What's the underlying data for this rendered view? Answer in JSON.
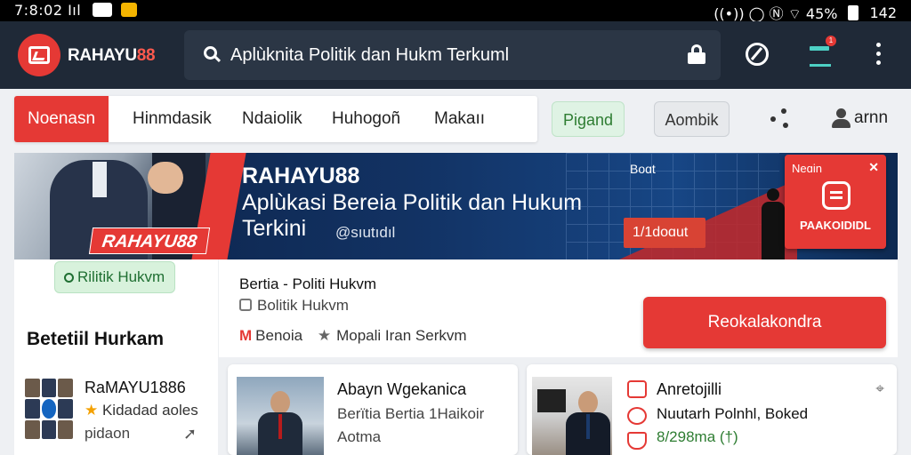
{
  "status_bar": {
    "time": "7:8:02 Iıl",
    "right_text": "((•)) ◯ Ⓝ  ⌔ 45%",
    "clock": "142"
  },
  "header": {
    "brand_prefix": "RAHAYU",
    "brand_suffix": "88",
    "search_value": "Aplùknita Politik dan Hukm Terkuml",
    "inbox_badge": "1"
  },
  "nav": {
    "tabs": [
      "Noenasn",
      "Hinmdasik",
      "Ndaiolik",
      "Huhogoñ",
      "Makaıı"
    ],
    "active_index": 0,
    "pill_green": "Pigand",
    "pill_gray": "Aombik",
    "user_label": "arnn"
  },
  "hero": {
    "tag": "RAHAYU88",
    "brand": "RAHAYU88",
    "title": "Aplùkasi Bereia Politik dan Hukum Terkini",
    "handle": "@sıutıdıl",
    "stat_top": "Boɑt",
    "stat_box": "1/1doɑut",
    "card_title": "Neɑin",
    "card_close": "✕",
    "card_label": "PAAKOIDIDL"
  },
  "left": {
    "chip": "Rilitik Hukvm",
    "heading": "Betetiil Hurkam",
    "item": {
      "name": "RaMAYU1886",
      "sub": "Kidadad aoles",
      "meta": "pidaon"
    }
  },
  "info": {
    "title": "Bertia - Politi Hukvm",
    "subtitle": "Bolitik Hukvm",
    "tag1_mark": "M",
    "tag1": "Benoia",
    "tag2": "Mopali Iran Serkvm",
    "cta_label": "Reokalakondra"
  },
  "cards": [
    {
      "title": "Abayn Wgekanica",
      "subtitle": "Berïtia Bertia 1Haikoir",
      "meta": "Aotma"
    },
    {
      "title": "Anretojilli",
      "subtitle": "Nuutarh Polnhl, Boked",
      "meta": "8/298ma (†)"
    }
  ],
  "colors": {
    "accent_red": "#e53935",
    "header_bg": "#1f2937",
    "green_chip": "#d8f2dc"
  }
}
